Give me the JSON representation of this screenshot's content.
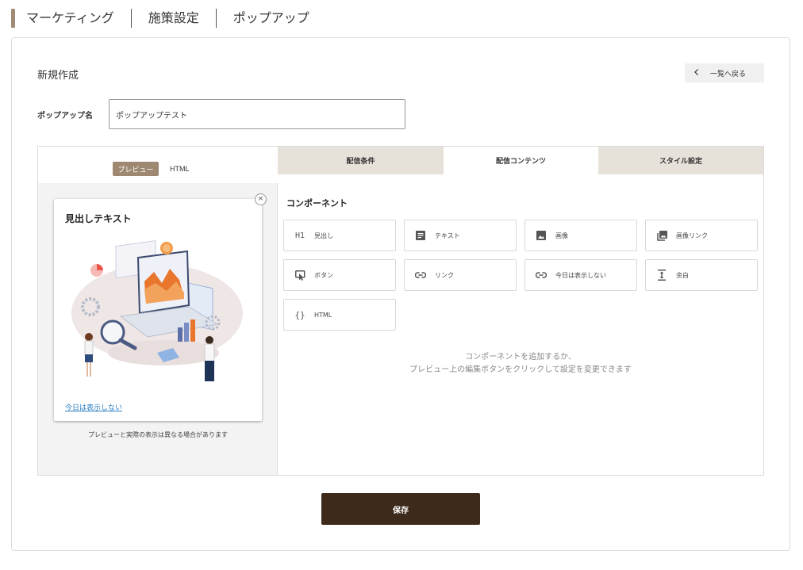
{
  "breadcrumb": {
    "items": [
      "マーケティング",
      "施策設定",
      "ポップアップ"
    ]
  },
  "page": {
    "title": "新規作成",
    "back_label": "一覧へ戻る",
    "back_icon": "chevron-left-icon"
  },
  "form": {
    "name_label": "ポップアップ名",
    "name_value": "ポップアップテスト"
  },
  "preview": {
    "toggle_preview": "プレビュー",
    "toggle_html": "HTML",
    "popup_heading": "見出しテキスト",
    "popup_link": "今日は表示しない",
    "close_symbol": "×",
    "note": "プレビューと実際の表示は異なる場合があります"
  },
  "tabs": [
    "配信条件",
    "配信コンテンツ",
    "スタイル設定"
  ],
  "components": {
    "title": "コンポーネント",
    "items": [
      {
        "label": "見出し",
        "icon": "h1-icon",
        "glyph": "H1"
      },
      {
        "label": "テキスト",
        "icon": "text-icon",
        "glyph": ""
      },
      {
        "label": "画像",
        "icon": "image-icon",
        "glyph": ""
      },
      {
        "label": "画像リンク",
        "icon": "image-link-icon",
        "glyph": ""
      },
      {
        "label": "ボタン",
        "icon": "button-icon",
        "glyph": ""
      },
      {
        "label": "リンク",
        "icon": "link-icon",
        "glyph": ""
      },
      {
        "label": "今日は表示しない",
        "icon": "link-icon",
        "glyph": ""
      },
      {
        "label": "余白",
        "icon": "spacing-icon",
        "glyph": ""
      },
      {
        "label": "HTML",
        "icon": "code-icon",
        "glyph": "{}"
      }
    ],
    "empty_line1": "コンポーネントを追加するか、",
    "empty_line2": "プレビュー上の編集ボタンをクリックして設定を変更できます"
  },
  "actions": {
    "save_label": "保存"
  },
  "colors": {
    "accent": "#9e8872",
    "primary_button": "#3d2a1a",
    "tab_inactive": "#e6e1d9",
    "link": "#2a7fc4"
  }
}
